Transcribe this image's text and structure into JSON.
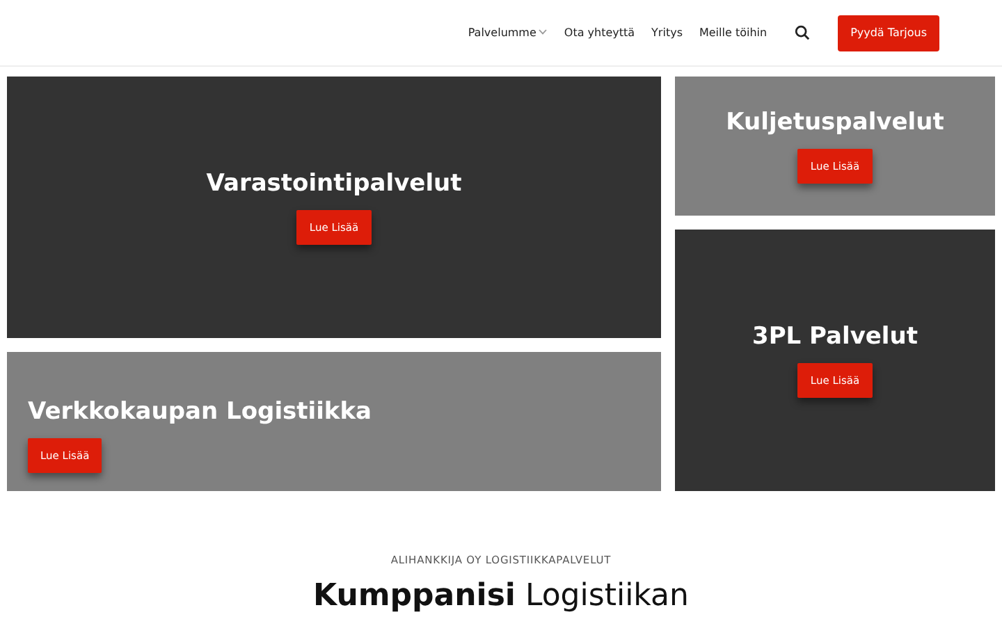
{
  "nav": {
    "items": [
      {
        "label": "Palvelumme",
        "dropdown": true
      },
      {
        "label": "Ota yhteyttä",
        "dropdown": false
      },
      {
        "label": "Yritys",
        "dropdown": false
      },
      {
        "label": "Meille töihin",
        "dropdown": false
      }
    ],
    "cta": "Pyydä Tarjous"
  },
  "tiles": [
    {
      "title": "Varastointipalvelut",
      "button": "Lue Lisää",
      "kind": "dark"
    },
    {
      "title": "Verkkokaupan Logistiikka",
      "button": "Lue Lisää",
      "kind": "light"
    },
    {
      "title": "Kuljetuspalvelut",
      "button": "Lue Lisää",
      "kind": "light"
    },
    {
      "title": "3PL Palvelut",
      "button": "Lue Lisää",
      "kind": "dark"
    }
  ],
  "intro": {
    "eyebrow": "ALIHANKKIJA OY LOGISTIIKKAPALVELUT",
    "heading": "**Kumppanisi** Logistiikan"
  }
}
